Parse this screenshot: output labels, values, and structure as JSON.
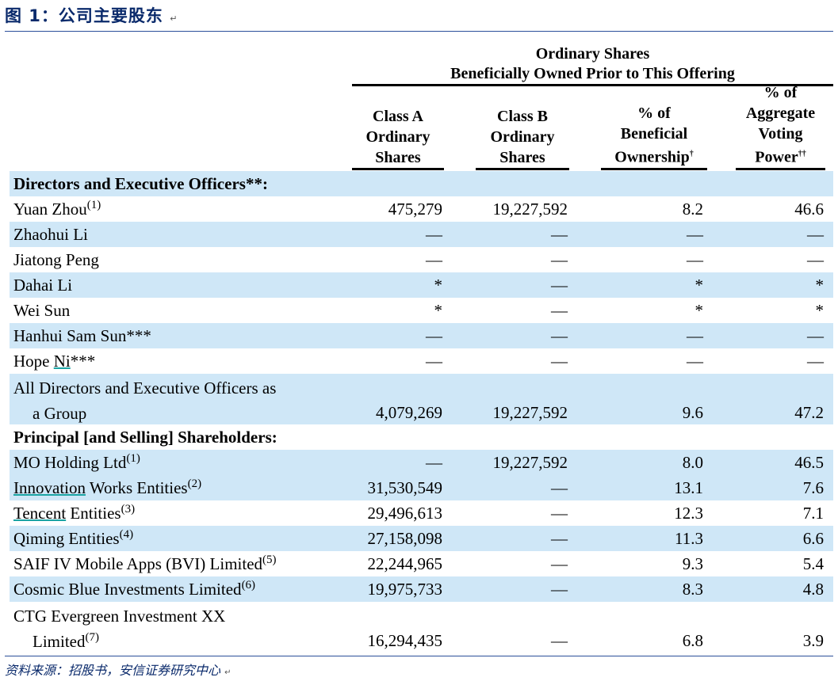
{
  "figure": {
    "title": "图 1：公司主要股东",
    "source": "资料来源：招股书，安信证券研究中心",
    "para_mark": "↵"
  },
  "header": {
    "super_line1": "Ordinary Shares",
    "super_line2": "Beneficially Owned Prior to This Offering",
    "columns": [
      {
        "lines": [
          "Class A",
          "Ordinary",
          "Shares"
        ],
        "suffix": ""
      },
      {
        "lines": [
          "Class B",
          "Ordinary",
          "Shares"
        ],
        "suffix": ""
      },
      {
        "lines": [
          "% of",
          "Beneficial",
          "Ownership"
        ],
        "suffix": "†"
      },
      {
        "lines": [
          "% of",
          "Aggregate",
          "Voting",
          "Power"
        ],
        "suffix": "††"
      }
    ]
  },
  "rows": [
    {
      "name": "Directors and Executive Officers**:",
      "section": true
    },
    {
      "name": "Yuan Zhou",
      "sup": "(1)",
      "a": "475,279",
      "b": "19,227,592",
      "pct": "8.2",
      "vote": "46.6"
    },
    {
      "name": "Zhaohui Li",
      "a": "—",
      "b": "—",
      "pct": "—",
      "vote": "—"
    },
    {
      "name": "Jiatong Peng",
      "a": "—",
      "b": "—",
      "pct": "—",
      "vote": "—"
    },
    {
      "name": "Dahai Li",
      "a": "*",
      "b": "—",
      "pct": "*",
      "vote": "*"
    },
    {
      "name": "Wei Sun",
      "a": "*",
      "b": "—",
      "pct": "*",
      "vote": "*"
    },
    {
      "name": "Hanhui Sam Sun***",
      "a": "—",
      "b": "—",
      "pct": "—",
      "vote": "—"
    },
    {
      "name_pre": "Hope ",
      "name_ul": "Ni",
      "name_post": "***",
      "a": "—",
      "b": "—",
      "pct": "—",
      "vote": "—"
    },
    {
      "name": "All Directors and Executive Officers as",
      "name2": "a Group",
      "tall": true,
      "a": "4,079,269",
      "b": "19,227,592",
      "pct": "9.6",
      "vote": "47.2"
    },
    {
      "name": "Principal [and Selling] Shareholders:",
      "section": true
    },
    {
      "name": "MO Holding Ltd",
      "sup": "(1)",
      "a": "—",
      "b": "19,227,592",
      "pct": "8.0",
      "vote": "46.5"
    },
    {
      "name_ul": "Innovation",
      "name_post": " Works Entities",
      "sup": "(2)",
      "a": "31,530,549",
      "b": "—",
      "pct": "13.1",
      "vote": "7.6"
    },
    {
      "name_ul": "Tencent",
      "name_post": " Entities",
      "sup": "(3)",
      "a": "29,496,613",
      "b": "—",
      "pct": "12.3",
      "vote": "7.1"
    },
    {
      "name": "Qiming Entities",
      "sup": "(4)",
      "a": "27,158,098",
      "b": "—",
      "pct": "11.3",
      "vote": "6.6"
    },
    {
      "name": "SAIF IV Mobile Apps (BVI) Limited",
      "sup": "(5)",
      "a": "22,244,965",
      "b": "—",
      "pct": "9.3",
      "vote": "5.4"
    },
    {
      "name": "Cosmic Blue Investments Limited",
      "sup": "(6)",
      "a": "19,975,733",
      "b": "—",
      "pct": "8.3",
      "vote": "4.8"
    },
    {
      "name": "CTG Evergreen Investment XX",
      "name2": "Limited",
      "sup": "(7)",
      "tall": true,
      "a": "16,294,435",
      "b": "—",
      "pct": "6.8",
      "vote": "3.9"
    }
  ]
}
